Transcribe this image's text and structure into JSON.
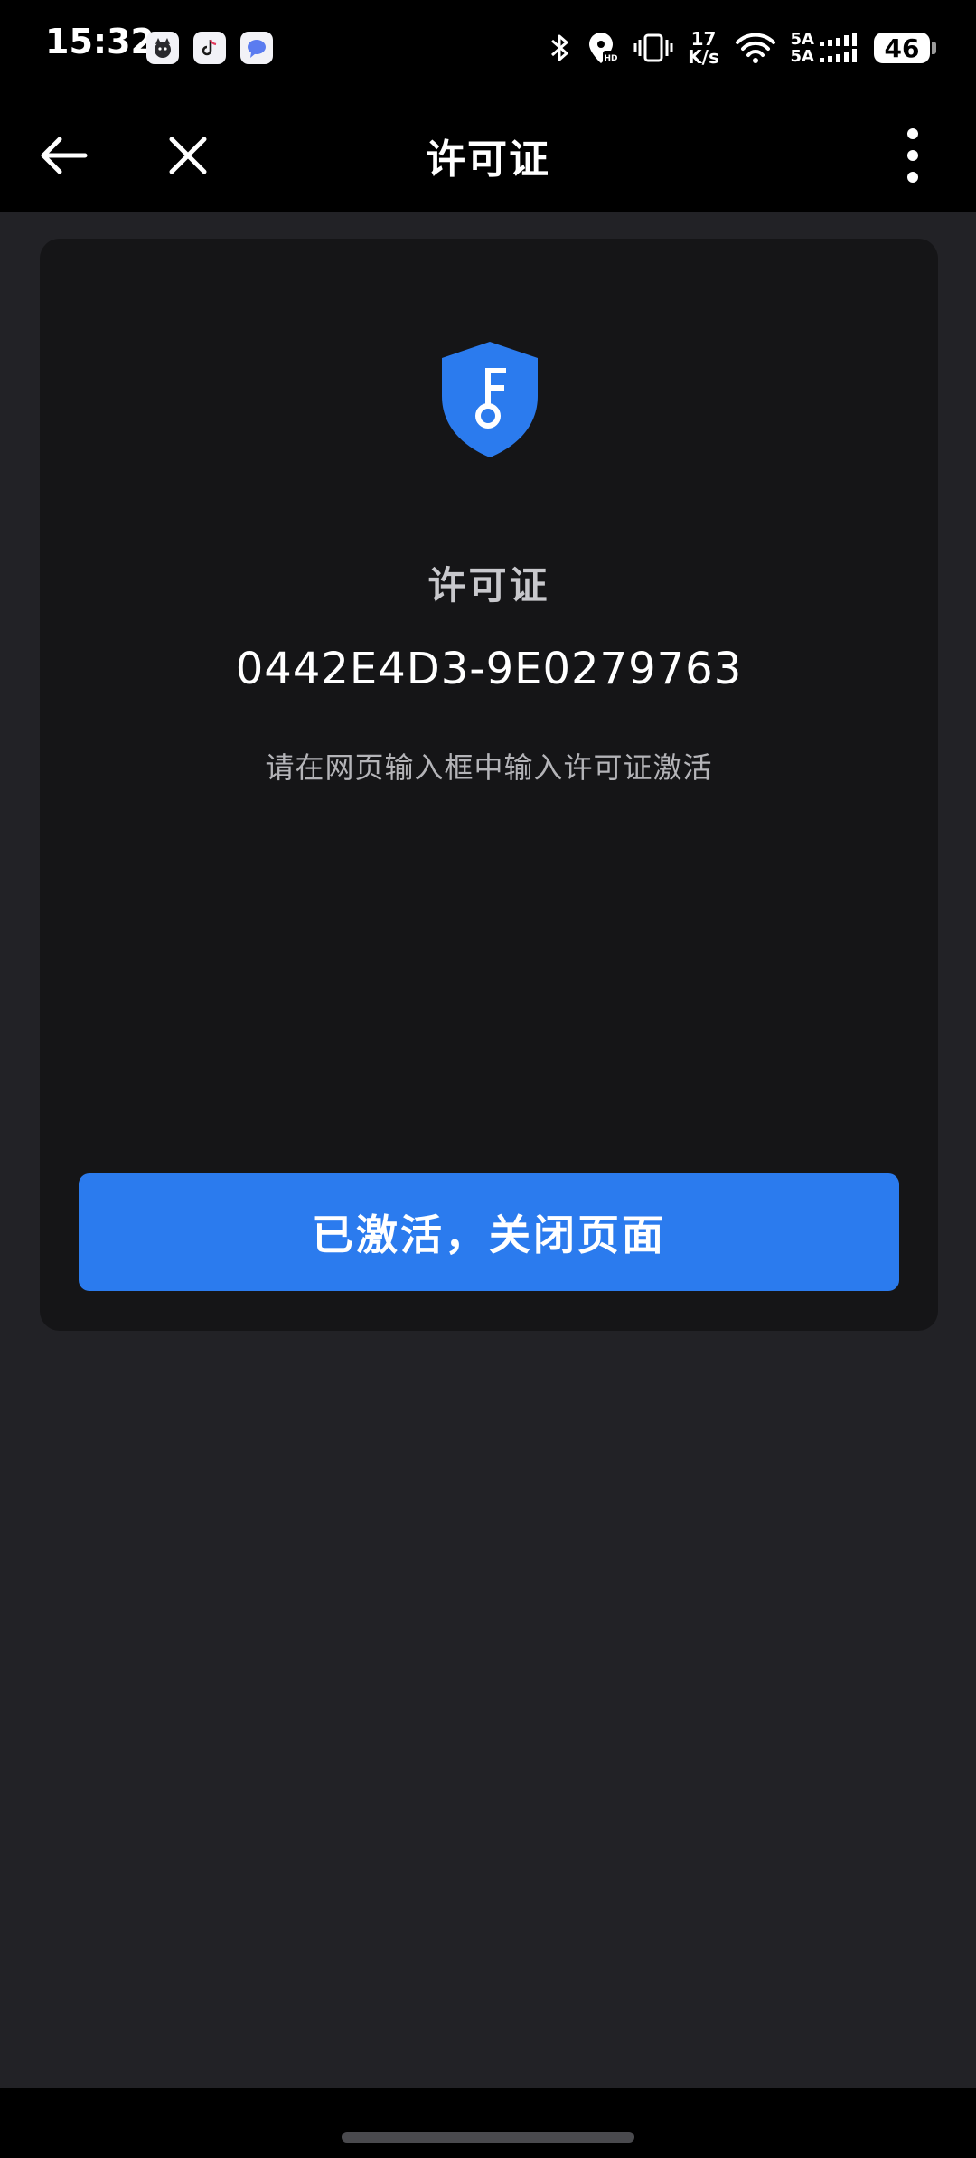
{
  "status_bar": {
    "time": "15:32",
    "net_speed_value": "17",
    "net_speed_unit": "K/s",
    "signal_1": "5A",
    "signal_2": "5A",
    "battery": "46"
  },
  "app_bar": {
    "title": "许可证"
  },
  "card": {
    "title": "许可证",
    "license_key": "0442E4D3-9E0279763",
    "hint": "请在网页输入框中输入许可证激活",
    "button_label": "已激活，关闭页面"
  },
  "colors": {
    "accent": "#2B7BEE",
    "card_bg": "#151517",
    "page_bg": "#222226"
  }
}
